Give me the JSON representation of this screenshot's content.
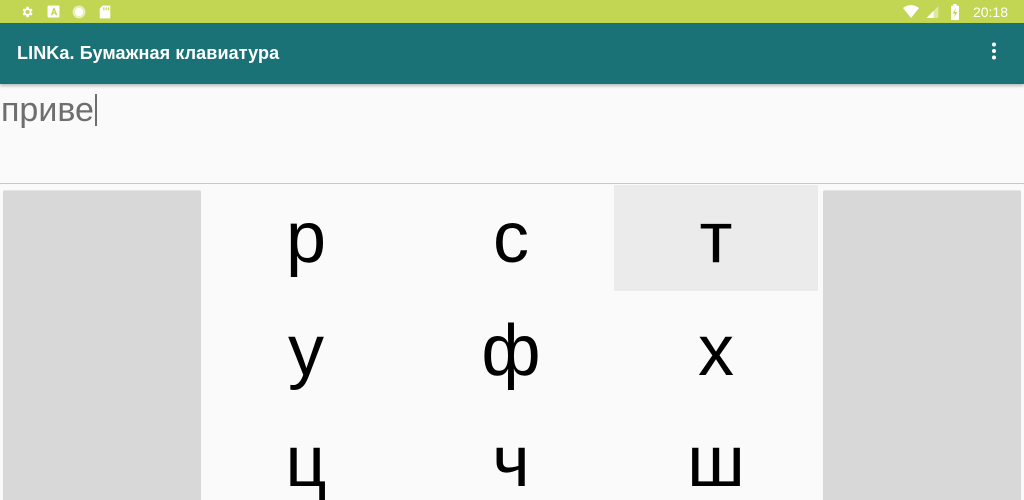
{
  "colors": {
    "status_bar": "#c2d653",
    "app_bar": "#1b7276",
    "side_panel": "#d7d8d7",
    "highlight_key": "#ebebeb"
  },
  "status_bar": {
    "left_icons": [
      "gear-icon",
      "text-a-icon",
      "circle-icon",
      "sd-card-icon"
    ],
    "right_icons": [
      "wifi-icon",
      "signal-icon",
      "battery-charging-icon"
    ],
    "time": "20:18"
  },
  "app_bar": {
    "title": "LINKa. Бумажная клавиатура",
    "menu_icon": "more-vert-icon"
  },
  "text_area": {
    "value": "приве"
  },
  "keyboard": {
    "rows": [
      [
        "р",
        "с",
        "т"
      ],
      [
        "у",
        "ф",
        "х"
      ],
      [
        "ц",
        "ч",
        "ш"
      ]
    ],
    "highlighted_key": "т"
  }
}
